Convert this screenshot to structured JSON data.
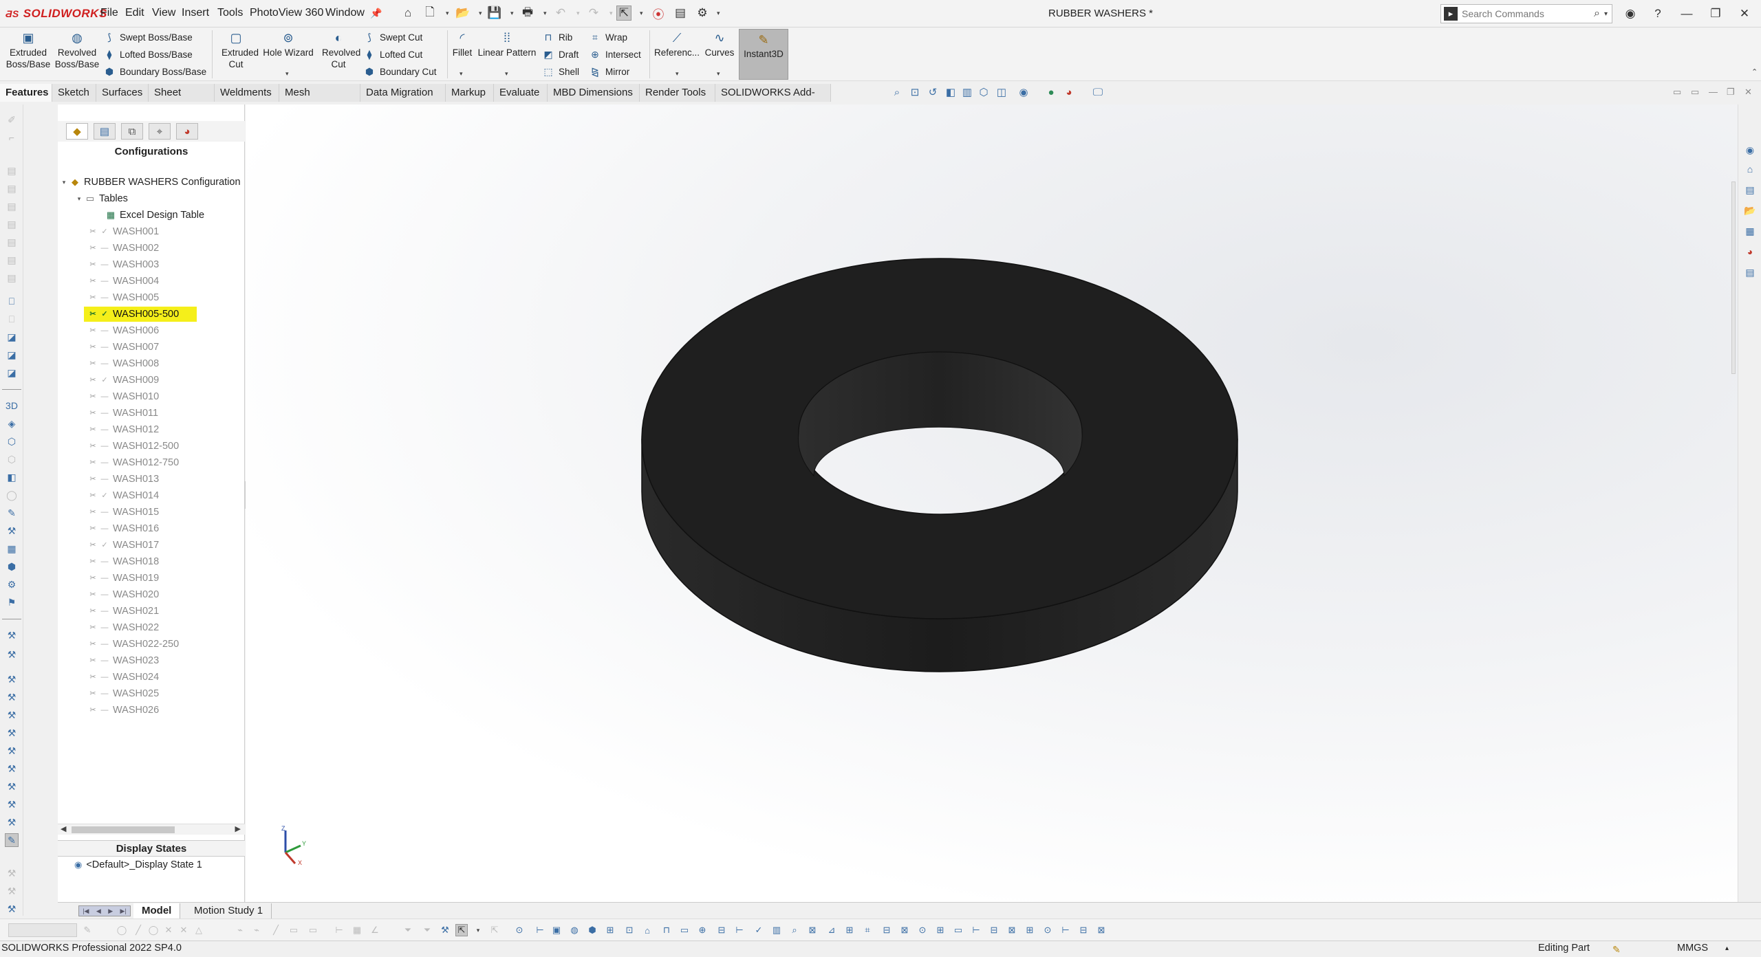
{
  "app": {
    "brand": "SOLIDWORKS",
    "document_title": "RUBBER WASHERS *"
  },
  "menu": [
    "File",
    "Edit",
    "View",
    "Insert",
    "Tools",
    "PhotoView 360",
    "Window"
  ],
  "search": {
    "placeholder": "Search Commands"
  },
  "command_manager": {
    "extruded_boss": "Extruded Boss/Base",
    "revolved_boss": "Revolved Boss/Base",
    "swept_boss": "Swept Boss/Base",
    "lofted_boss": "Lofted Boss/Base",
    "boundary_boss": "Boundary Boss/Base",
    "extruded_cut": "Extruded Cut",
    "hole_wizard": "Hole Wizard",
    "revolved_cut": "Revolved Cut",
    "swept_cut": "Swept Cut",
    "lofted_cut": "Lofted Cut",
    "boundary_cut": "Boundary Cut",
    "fillet": "Fillet",
    "linear_pattern": "Linear Pattern",
    "rib": "Rib",
    "draft": "Draft",
    "shell": "Shell",
    "wrap": "Wrap",
    "intersect": "Intersect",
    "mirror": "Mirror",
    "reference": "Referenc...",
    "curves": "Curves",
    "instant3d": "Instant3D"
  },
  "tabs": [
    "Features",
    "Sketch",
    "Surfaces",
    "Sheet Metal",
    "Weldments",
    "Mesh Modeling",
    "Data Migration",
    "Markup",
    "Evaluate",
    "MBD Dimensions",
    "Render Tools",
    "SOLIDWORKS Add-Ins"
  ],
  "active_tab": "Features",
  "feature_manager": {
    "title": "Configurations",
    "root": "RUBBER WASHERS Configuration",
    "tables": "Tables",
    "design_table": "Excel Design Table",
    "configurations": [
      {
        "name": "WASH001",
        "checked": true
      },
      {
        "name": "WASH002",
        "checked": false
      },
      {
        "name": "WASH003",
        "checked": false
      },
      {
        "name": "WASH004",
        "checked": false
      },
      {
        "name": "WASH005",
        "checked": false
      },
      {
        "name": "WASH005-500",
        "checked": true,
        "active": true
      },
      {
        "name": "WASH006",
        "checked": false
      },
      {
        "name": "WASH007",
        "checked": false
      },
      {
        "name": "WASH008",
        "checked": false
      },
      {
        "name": "WASH009",
        "checked": true
      },
      {
        "name": "WASH010",
        "checked": false
      },
      {
        "name": "WASH011",
        "checked": false
      },
      {
        "name": "WASH012",
        "checked": false
      },
      {
        "name": "WASH012-500",
        "checked": false
      },
      {
        "name": "WASH012-750",
        "checked": false
      },
      {
        "name": "WASH013",
        "checked": false
      },
      {
        "name": "WASH014",
        "checked": true
      },
      {
        "name": "WASH015",
        "checked": false
      },
      {
        "name": "WASH016",
        "checked": false
      },
      {
        "name": "WASH017",
        "checked": true
      },
      {
        "name": "WASH018",
        "checked": false
      },
      {
        "name": "WASH019",
        "checked": false
      },
      {
        "name": "WASH020",
        "checked": false
      },
      {
        "name": "WASH021",
        "checked": false
      },
      {
        "name": "WASH022",
        "checked": false
      },
      {
        "name": "WASH022-250",
        "checked": false
      },
      {
        "name": "WASH023",
        "checked": false
      },
      {
        "name": "WASH024",
        "checked": false
      },
      {
        "name": "WASH025",
        "checked": false
      },
      {
        "name": "WASH026",
        "checked": false
      }
    ],
    "display_states_title": "Display States",
    "display_state": "<Default>_Display State 1"
  },
  "model_tabs": [
    "Model",
    "Motion Study 1"
  ],
  "active_model_tab": "Model",
  "status": {
    "product": "SOLIDWORKS Professional 2022 SP4.0",
    "mode": "Editing Part",
    "units": "MMGS"
  },
  "colors": {
    "brand_red": "#d02020",
    "highlight_yellow": "#f5ef1a",
    "part_color": "#1f1f1f"
  }
}
